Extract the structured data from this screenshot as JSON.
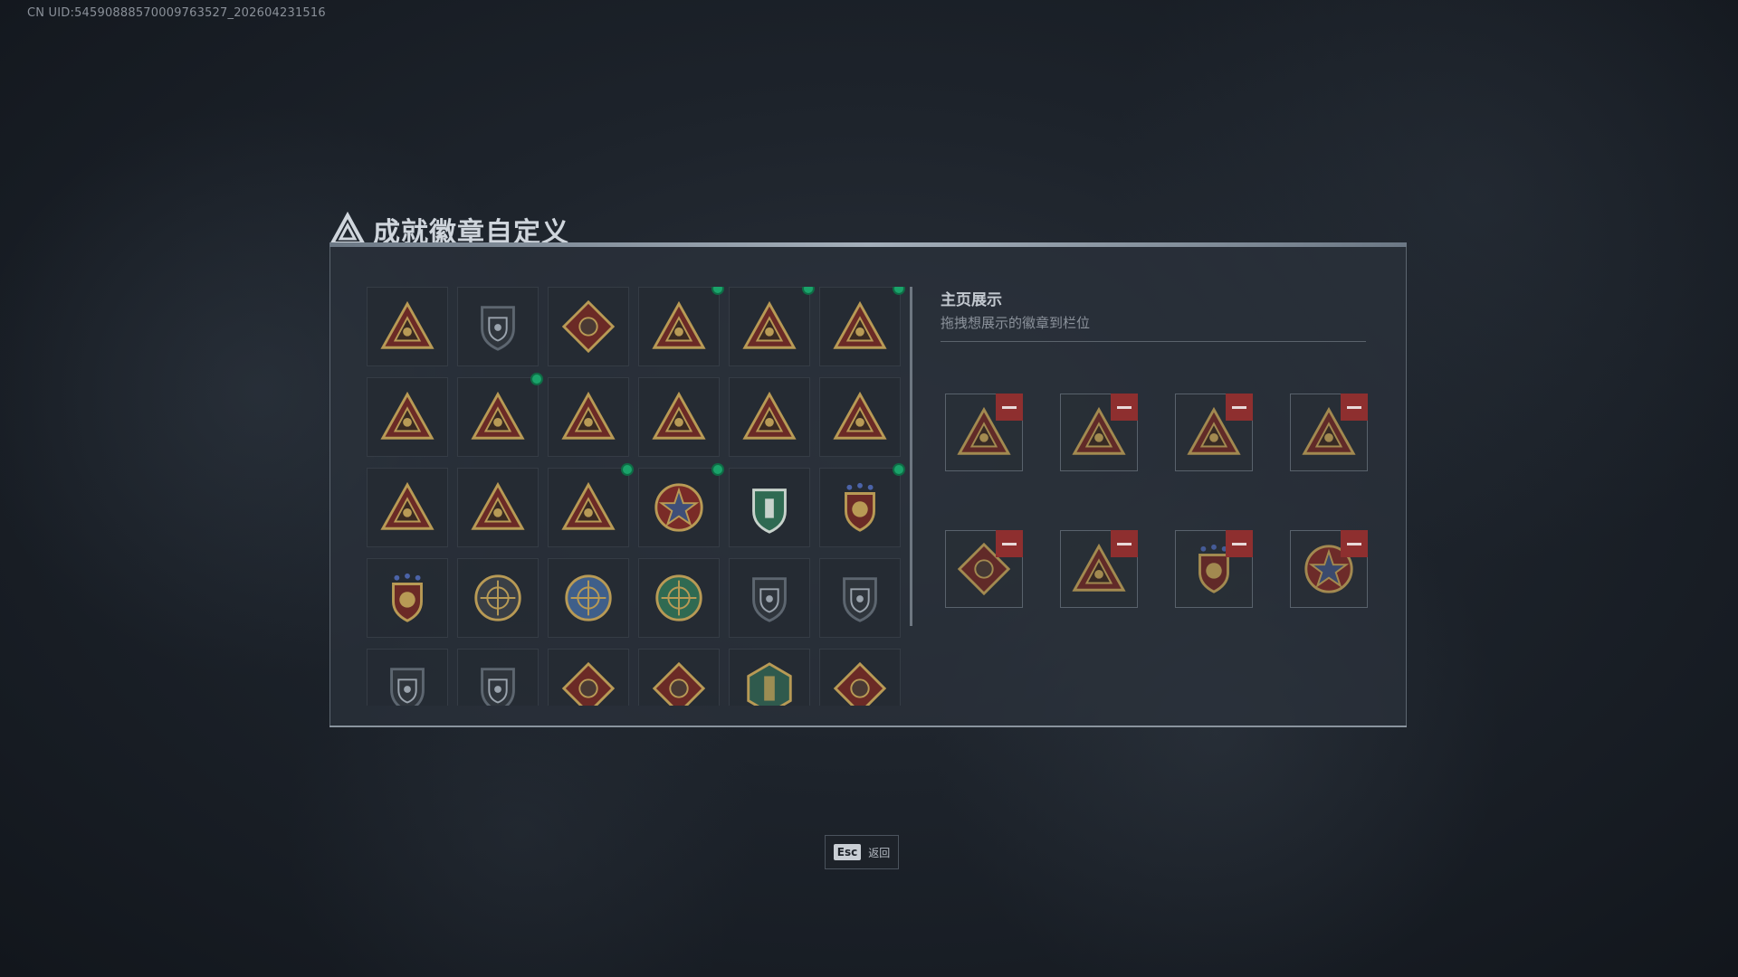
{
  "uid_text": "CN UID:5459088857000976352​7_202604231516",
  "title": "成就徽章自定义",
  "showcase": {
    "title": "主页展示",
    "subtitle": "拖拽想展示的徽章到栏位"
  },
  "badges": [
    {
      "icon": "shield-triangle-badge-icon",
      "new": false
    },
    {
      "icon": "helicopter-shield-badge-icon",
      "new": false
    },
    {
      "icon": "diamond-shield-badge-icon",
      "new": false
    },
    {
      "icon": "eagle-triangle-badge-icon",
      "new": true
    },
    {
      "icon": "fortress-triangle-badge-icon",
      "new": true
    },
    {
      "icon": "vault-95-triangle-badge-icon",
      "new": true
    },
    {
      "icon": "ammo-56-triangle-badge-icon",
      "new": false
    },
    {
      "icon": "canister-triangle-badge-icon",
      "new": true
    },
    {
      "icon": "ammo-58-triangle-badge-icon",
      "new": false
    },
    {
      "icon": "boat-triangle-badge-icon",
      "new": false
    },
    {
      "icon": "rifle-triangle-badge-icon",
      "new": false
    },
    {
      "icon": "number-one-triangle-badge-icon",
      "new": false
    },
    {
      "icon": "runner-triangle-badge-icon",
      "new": false
    },
    {
      "icon": "squad-triangle-badge-icon",
      "new": false
    },
    {
      "icon": "rocket-triangle-badge-icon",
      "new": true
    },
    {
      "icon": "star-medal-badge-icon",
      "new": true
    },
    {
      "icon": "green-crest-badge-icon",
      "new": false
    },
    {
      "icon": "stars-shield-badge-icon",
      "new": true
    },
    {
      "icon": "red-stars-shield-badge-icon",
      "new": false
    },
    {
      "icon": "skull-round-badge-icon",
      "new": false
    },
    {
      "icon": "blue-crosshair-badge-icon",
      "new": false
    },
    {
      "icon": "green-crosshair-badge-icon",
      "new": false
    },
    {
      "icon": "rifle-scope-shield-badge-icon",
      "new": false
    },
    {
      "icon": "sniper-scope-shield-badge-icon",
      "new": false
    },
    {
      "icon": "pistol-shield-badge-icon",
      "new": false
    },
    {
      "icon": "crossed-rifles-shield-badge-icon",
      "new": false
    },
    {
      "icon": "wolf-diamond-badge-icon",
      "new": false
    },
    {
      "icon": "wolf-red-diamond-badge-icon",
      "new": false
    },
    {
      "icon": "knife-hexagon-badge-icon",
      "new": false
    },
    {
      "icon": "dragon-diamond-badge-icon",
      "new": false
    }
  ],
  "slots": [
    {
      "icon": "canister-triangle-badge-icon"
    },
    {
      "icon": "eagle-triangle-badge-icon"
    },
    {
      "icon": "fortress-triangle-badge-icon"
    },
    {
      "icon": "vault-95-triangle-badge-icon"
    },
    {
      "icon": "runner-diamond-badge-icon"
    },
    {
      "icon": "rocket-triangle-badge-icon"
    },
    {
      "icon": "stars-shield-badge-icon"
    },
    {
      "icon": "star-medal-badge-icon"
    }
  ],
  "esc": {
    "key": "Esc",
    "label": "返回"
  },
  "colors": {
    "gold": "#b89a55",
    "dark_red": "#6b2a26",
    "steel": "#5d6670",
    "new_dot": "#1aa36a",
    "remove": "#8e2f2f"
  }
}
